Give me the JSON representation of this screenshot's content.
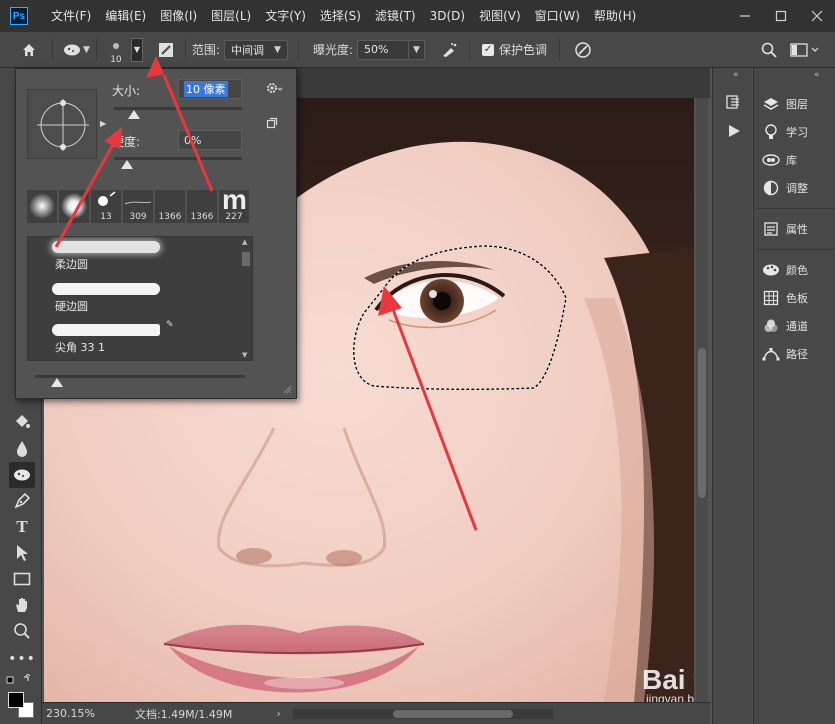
{
  "app": {
    "logo": "Ps"
  },
  "menu": [
    "文件(F)",
    "编辑(E)",
    "图像(I)",
    "图层(L)",
    "文字(Y)",
    "选择(S)",
    "滤镜(T)",
    "3D(D)",
    "视图(V)",
    "窗口(W)",
    "帮助(H)"
  ],
  "options": {
    "brush_size": "10",
    "range_label": "范围:",
    "range_value": "中间调",
    "exposure_label": "曝光度:",
    "exposure_value": "50%",
    "protect_label": "保护色调",
    "protect_checked": true
  },
  "brush_popup": {
    "size_label": "大小:",
    "size_value": "10 像素",
    "hardness_label": "硬度:",
    "hardness_value": "0%",
    "size_slider_fraction": 0.03,
    "hardness_slider_fraction": 0.0,
    "presets": [
      {
        "kind": "soft",
        "num": ""
      },
      {
        "kind": "soft",
        "num": ""
      },
      {
        "kind": "hard",
        "num": "13"
      },
      {
        "kind": "line",
        "num": "309"
      },
      {
        "kind": "blank",
        "num": "1366"
      },
      {
        "kind": "blank",
        "num": "1366"
      },
      {
        "kind": "glyph",
        "glyph": "m",
        "num": "227"
      }
    ],
    "brushes": [
      {
        "name": "柔边圆"
      },
      {
        "name": "硬边圆"
      },
      {
        "name": "尖角  33 1"
      }
    ]
  },
  "panels": [
    {
      "icon": "layers-icon",
      "label": "图层"
    },
    {
      "icon": "learn-icon",
      "label": "学习"
    },
    {
      "icon": "library-icon",
      "label": "库"
    },
    {
      "icon": "adjustments-icon",
      "label": "调整"
    },
    {
      "icon": "properties-icon",
      "label": "属性"
    },
    {
      "icon": "color-icon",
      "label": "颜色"
    },
    {
      "icon": "swatches-icon",
      "label": "色板"
    },
    {
      "icon": "channels-icon",
      "label": "通道"
    },
    {
      "icon": "paths-icon",
      "label": "路径"
    }
  ],
  "status": {
    "zoom": "230.15%",
    "doc": "文档:1.49M/1.49M"
  },
  "watermark": {
    "logo": "Bai 经验",
    "url": "jingyan.baidu.com"
  },
  "colors": {
    "accent_arrow": "#e8383d",
    "selection": "#ffffff",
    "ps_blue": "#31a8ff"
  }
}
